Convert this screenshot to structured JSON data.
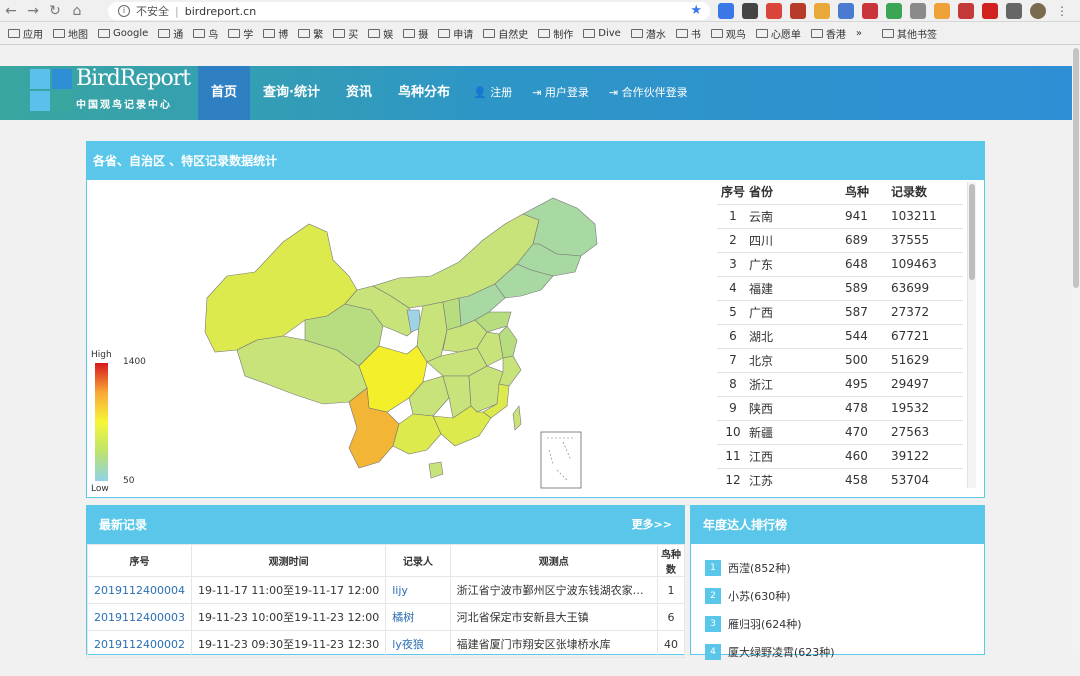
{
  "browser": {
    "security_label": "不安全",
    "url": "birdreport.cn",
    "bookmarks": [
      "应用",
      "地图",
      "Google",
      "通",
      "鸟",
      "学",
      "博",
      "繁",
      "买",
      "娱",
      "摄",
      "申请",
      "自然史",
      "制作",
      "Dive",
      "潜水",
      "书",
      "观鸟",
      "心愿单",
      "香港",
      "其他书签"
    ],
    "overflow": "»"
  },
  "site": {
    "logo_text": "BirdReport",
    "logo_sub": "中国观鸟记录中心",
    "nav": [
      "首页",
      "查询·统计",
      "资讯",
      "鸟种分布"
    ],
    "nav_small": [
      "注册",
      "用户登录",
      "合作伙伴登录"
    ]
  },
  "map_panel": {
    "title": "各省、自治区 、特区记录数据统计",
    "legend_high": "High",
    "legend_low": "Low",
    "legend_max": "1400",
    "legend_min": "50",
    "table_headers": [
      "序号",
      "省份",
      "鸟种",
      "记录数"
    ],
    "rows": [
      [
        "1",
        "云南",
        "941",
        "103211"
      ],
      [
        "2",
        "四川",
        "689",
        "37555"
      ],
      [
        "3",
        "广东",
        "648",
        "109463"
      ],
      [
        "4",
        "福建",
        "589",
        "63699"
      ],
      [
        "5",
        "广西",
        "587",
        "27372"
      ],
      [
        "6",
        "湖北",
        "544",
        "67721"
      ],
      [
        "7",
        "北京",
        "500",
        "51629"
      ],
      [
        "8",
        "浙江",
        "495",
        "29497"
      ],
      [
        "9",
        "陕西",
        "478",
        "19532"
      ],
      [
        "10",
        "新疆",
        "470",
        "27563"
      ],
      [
        "11",
        "江西",
        "460",
        "39122"
      ],
      [
        "12",
        "江苏",
        "458",
        "53704"
      ]
    ],
    "map_colors": {
      "low": "#a9d9a3",
      "mid_low": "#c7e37a",
      "mid": "#dcea4e",
      "yellow": "#f3ef2a",
      "orange": "#f2b536",
      "blue": "#9ed3e6"
    }
  },
  "records_panel": {
    "title": "最新记录",
    "more": "更多>>",
    "headers": [
      "序号",
      "观测时间",
      "记录人",
      "观测点",
      "鸟种数"
    ],
    "rows": [
      [
        "2019112400004",
        "19-11-17 11:00至19-11-17 12:00",
        "lijy",
        "浙江省宁波市鄞州区宁波东钱湖农家…",
        "1"
      ],
      [
        "2019112400003",
        "19-11-23 10:00至19-11-23 12:00",
        "橘树",
        "河北省保定市安新县大王镇",
        "6"
      ],
      [
        "2019112400002",
        "19-11-23 09:30至19-11-23 12:30",
        "ly夜狼",
        "福建省厦门市翔安区张埭桥水库",
        "40"
      ]
    ]
  },
  "ranking_panel": {
    "title": "年度达人排行榜",
    "items": [
      {
        "rank": "1",
        "label": "西滢(852种)"
      },
      {
        "rank": "2",
        "label": "小苏(630种)"
      },
      {
        "rank": "3",
        "label": "雁归羽(624种)"
      },
      {
        "rank": "4",
        "label": "厦大绿野凌霄(623种)"
      }
    ]
  }
}
